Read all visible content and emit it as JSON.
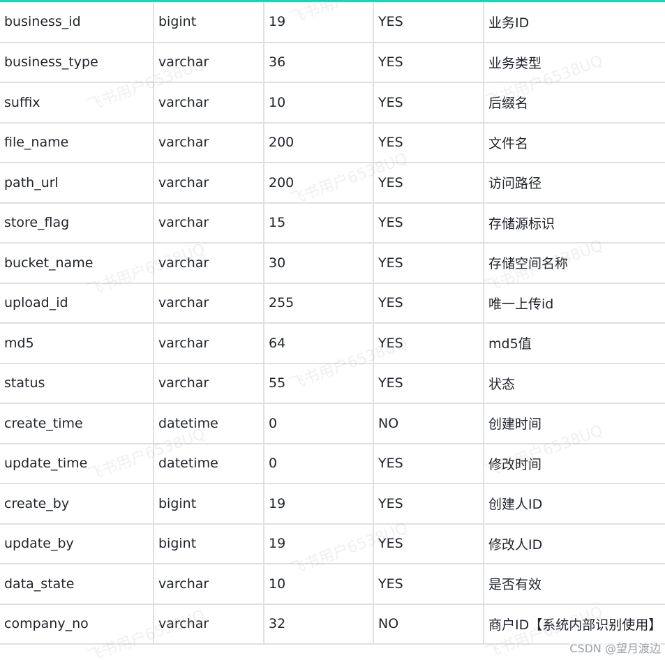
{
  "rows": [
    [
      "business_id",
      "bigint",
      "19",
      "YES",
      "业务ID"
    ],
    [
      "business_type",
      "varchar",
      "36",
      "YES",
      "业务类型"
    ],
    [
      "suffix",
      "varchar",
      "10",
      "YES",
      "后缀名"
    ],
    [
      "file_name",
      "varchar",
      "200",
      "YES",
      "文件名"
    ],
    [
      "path_url",
      "varchar",
      "200",
      "YES",
      "访问路径"
    ],
    [
      "store_flag",
      "varchar",
      "15",
      "YES",
      "存储源标识"
    ],
    [
      "bucket_name",
      "varchar",
      "30",
      "YES",
      "存储空间名称"
    ],
    [
      "upload_id",
      "varchar",
      "255",
      "YES",
      "唯一上传id"
    ],
    [
      "md5",
      "varchar",
      "64",
      "YES",
      "md5值"
    ],
    [
      "status",
      "varchar",
      "55",
      "YES",
      "状态"
    ],
    [
      "create_time",
      "datetime",
      "0",
      "NO",
      "创建时间"
    ],
    [
      "update_time",
      "datetime",
      "0",
      "YES",
      "修改时间"
    ],
    [
      "create_by",
      "bigint",
      "19",
      "YES",
      "创建人ID"
    ],
    [
      "update_by",
      "bigint",
      "19",
      "YES",
      "修改人ID"
    ],
    [
      "data_state",
      "varchar",
      "10",
      "YES",
      "是否有效"
    ],
    [
      "company_no",
      "varchar",
      "32",
      "NO",
      "商户ID【系统内部识别使用】"
    ]
  ],
  "watermark": {
    "text": "飞书用户6538UQ"
  },
  "footer": {
    "credit": "CSDN @望月渡边"
  },
  "colors": {
    "accent": "#1fd1b6",
    "grid": "#dee0e3"
  }
}
